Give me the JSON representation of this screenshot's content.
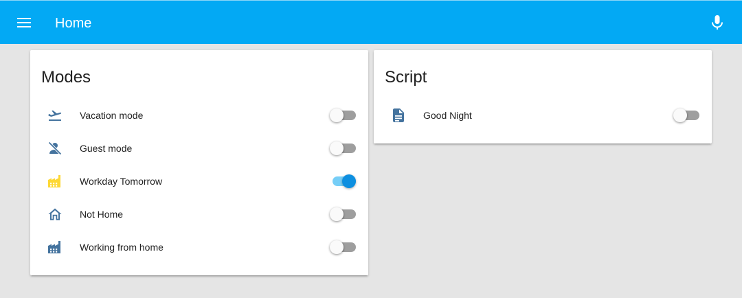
{
  "header": {
    "title": "Home",
    "menu_icon": "menu-icon",
    "mic_icon": "microphone-icon",
    "background": "#03a9f4"
  },
  "cards": [
    {
      "title": "Modes",
      "rows": [
        {
          "label": "Vacation mode",
          "icon": "airplane-takeoff-icon",
          "icon_color": "#44739e",
          "state": "off"
        },
        {
          "label": "Guest mode",
          "icon": "account-off-icon",
          "icon_color": "#44739e",
          "state": "off"
        },
        {
          "label": "Workday Tomorrow",
          "icon": "factory-icon",
          "icon_color": "#fdd835",
          "state": "on"
        },
        {
          "label": "Not Home",
          "icon": "home-outline-icon",
          "icon_color": "#44739e",
          "state": "off"
        },
        {
          "label": "Working from home",
          "icon": "factory-icon",
          "icon_color": "#44739e",
          "state": "off"
        }
      ]
    },
    {
      "title": "Script",
      "rows": [
        {
          "label": "Good Night",
          "icon": "file-document-icon",
          "icon_color": "#44739e",
          "state": "off"
        }
      ]
    }
  ],
  "colors": {
    "toggle_on_thumb": "#0d8fe0",
    "toggle_on_track": "#76cef7",
    "toggle_off_track": "#9e9e9e",
    "page_background": "#e5e5e5"
  }
}
